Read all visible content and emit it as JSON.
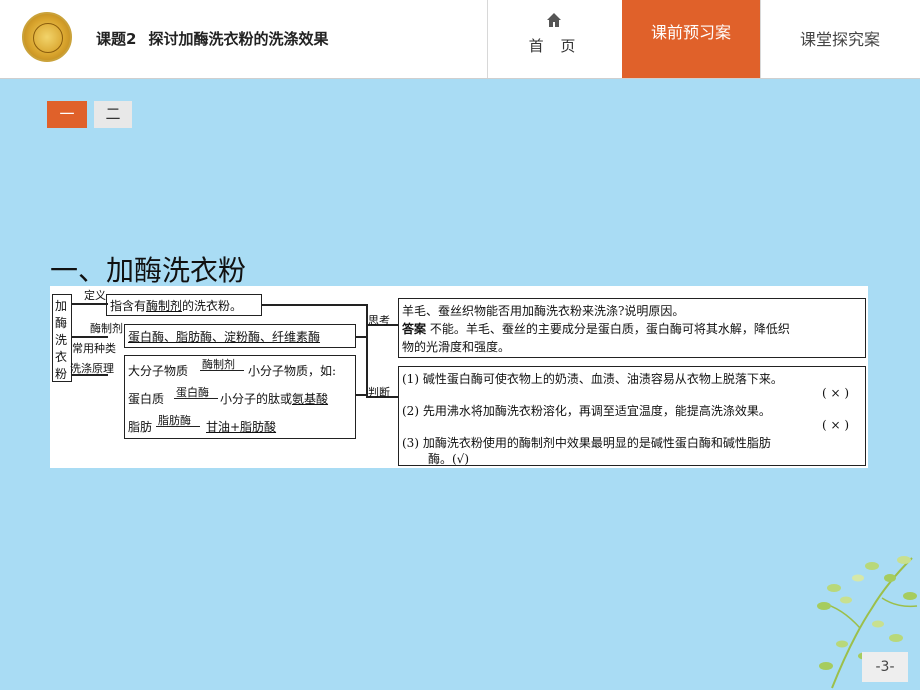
{
  "header": {
    "lesson": "课题2",
    "title": "探讨加酶洗衣粉的洗涤效果",
    "home_label": "首 页",
    "tabs": [
      "课前预习案",
      "课堂探究案"
    ]
  },
  "pager": [
    "一",
    "二"
  ],
  "section_title": "一、加酶洗衣粉",
  "diagram": {
    "root": [
      "加",
      "酶",
      "洗",
      "衣",
      "粉"
    ],
    "branch_def": "定义",
    "def_text_pre": "指含有",
    "def_text_em": "酶制剂",
    "def_text_post": "的洗衣粉。",
    "branch_kinds_1": "酶制剂",
    "branch_kinds_2": "常用种类",
    "kinds_text": "蛋白酶、脂肪酶、淀粉酶、纤维素酶",
    "branch_principle": "洗涤原理",
    "p1_left": "大分子物质",
    "p1_arrow": "酶制剂",
    "p1_right": "小分子物质，如:",
    "p2_left": "蛋白质",
    "p2_arrow": "蛋白酶",
    "p2_right_pre": "小分子的肽或",
    "p2_right_em": "氨基酸",
    "p3_left": "脂肪",
    "p3_arrow": "脂肪酶",
    "p3_right": "甘油+脂肪酸",
    "think_label": "思考",
    "think_q": "羊毛、蚕丝织物能否用加酶洗衣粉来洗涤?说明原因。",
    "think_ans_label": "答案",
    "think_ans_1": "不能。羊毛、蚕丝的主要成分是蛋白质，蛋白酶可将其水解，降低织",
    "think_ans_2": "物的光滑度和强度。",
    "judge_label": "判断",
    "j1": "(1) 碱性蛋白酶可使衣物上的奶渍、血渍、油渍容易从衣物上脱落下来。",
    "j1_mark": "( × )",
    "j2": "(2) 先用沸水将加酶洗衣粉溶化，再调至适宜温度，能提高洗涤效果。",
    "j2_mark": "( × )",
    "j3_1": "(3) 加酶洗衣粉使用的酶制剂中效果最明显的是碱性蛋白酶和碱性脂肪",
    "j3_2": "酶。(√)"
  },
  "page_number": "-3-",
  "colors": {
    "accent": "#e0612a",
    "background": "#a9dcf4"
  }
}
